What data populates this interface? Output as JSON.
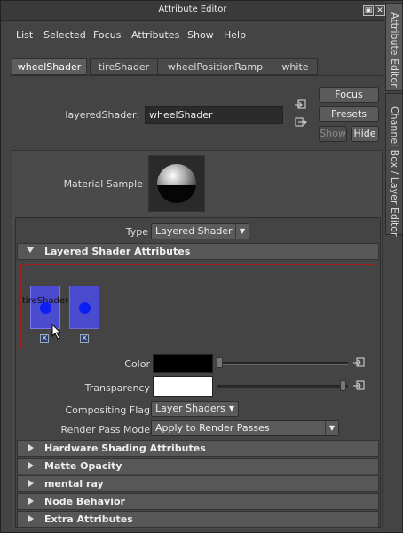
{
  "window": {
    "title": "Attribute Editor"
  },
  "menu": [
    "List",
    "Selected",
    "Focus",
    "Attributes",
    "Show",
    "Help"
  ],
  "tabs": [
    "wheelShader",
    "tireShader",
    "wheelPositionRamp",
    "white"
  ],
  "node": {
    "label": "layeredShader:",
    "value": "wheelShader"
  },
  "buttons": {
    "focus": "Focus",
    "presets": "Presets",
    "show": "Show",
    "hide": "Hide"
  },
  "material_sample": {
    "label": "Material Sample"
  },
  "type": {
    "label": "Type",
    "value": "Layered Shader"
  },
  "sections": {
    "layered": "Layered Shader Attributes",
    "hardware": "Hardware Shading Attributes",
    "matte": "Matte Opacity",
    "mental_ray": "mental ray",
    "node_behavior": "Node Behavior",
    "extra": "Extra Attributes"
  },
  "layers": [
    {
      "name": "tireShader",
      "selected": true
    },
    {
      "name": "",
      "selected": false
    }
  ],
  "attributes": {
    "color": {
      "label": "Color",
      "swatch": "#000000",
      "slider": 0.0
    },
    "transparency": {
      "label": "Transparency",
      "swatch": "#ffffff",
      "slider": 1.0
    },
    "compositing": {
      "label": "Compositing Flag",
      "value": "Layer Shaders"
    },
    "render_pass": {
      "label": "Render Pass Mode",
      "value": "Apply to Render Passes"
    }
  },
  "side_tabs": [
    "Attribute Editor",
    "Channel Box / Layer Editor"
  ],
  "colors": {
    "layer_fill": "#4b4bcf",
    "layer_dot": "#0a1ef5",
    "highlight_border": "#a02020"
  }
}
